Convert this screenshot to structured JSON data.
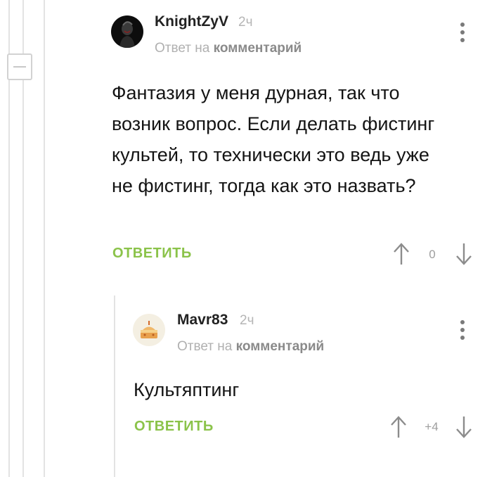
{
  "comment": {
    "author": "KnightZyV",
    "time": "2ч",
    "reply_prefix": "Ответ на",
    "reply_link": "комментарий",
    "text": "Фантазия у меня дурная, так что возник вопрос. Если делать фистинг культей, то технически это ведь уже не фистинг, тогда как это назвать?",
    "reply_label": "ОТВЕТИТЬ",
    "rating": "0"
  },
  "reply": {
    "author": "Mavr83",
    "time": "2ч",
    "reply_prefix": "Ответ на",
    "reply_link": "комментарий",
    "text": "Культяптинг",
    "reply_label": "ОТВЕТИТЬ",
    "rating": "+4"
  },
  "colors": {
    "accent": "#8bc34a",
    "thread_line": "#e3e3e3",
    "muted_text": "#b0b0b0",
    "menu_dots": "#7a7a7a"
  },
  "icons": [
    "collapse-icon",
    "avatar-joker",
    "avatar-cake",
    "more-vertical-icon",
    "arrow-up-icon",
    "arrow-down-icon"
  ]
}
